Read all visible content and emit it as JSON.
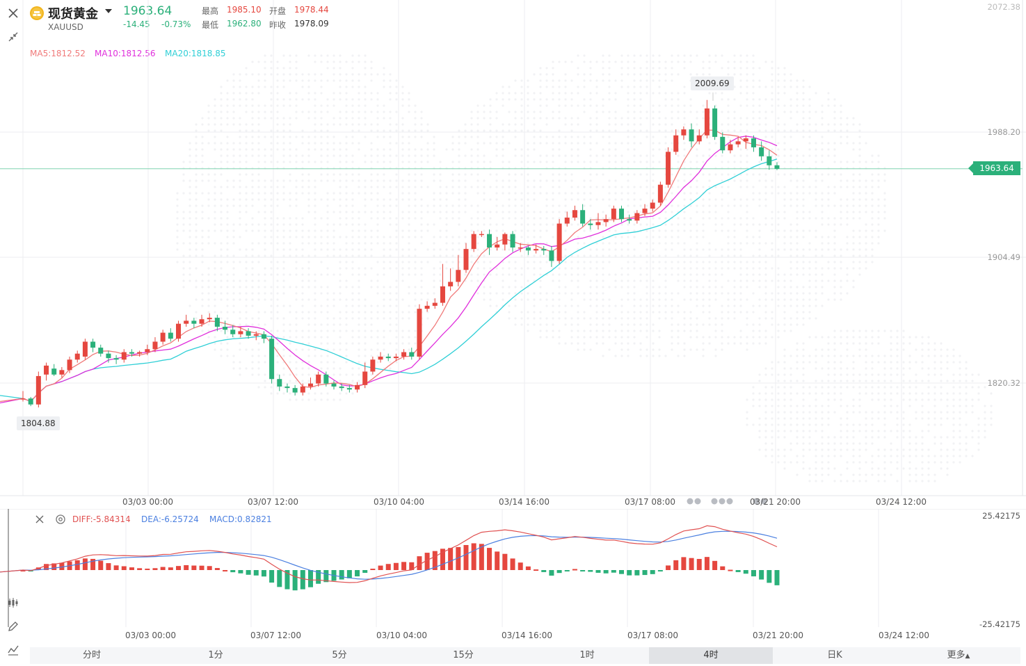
{
  "header": {
    "name": "现货黄金",
    "symbol": "XAUUSD",
    "price": "1963.64",
    "change": "-14.45",
    "change_pct": "-0.73%",
    "high_label": "最高",
    "high_value": "1985.10",
    "open_label": "开盘",
    "open_value": "1978.44",
    "low_label": "最低",
    "low_value": "1962.80",
    "prev_label": "昨收",
    "prev_value": "1978.09"
  },
  "ma_legend": {
    "ma5": "MA5:1812.52",
    "ma10": "MA10:1812.56",
    "ma20": "MA20:1818.85"
  },
  "price_axis": {
    "top": "2072.38",
    "t1": "1988.20",
    "t2": "1904.49",
    "t3": "1820.32"
  },
  "current_price_tag": "1963.64",
  "max_callout": "2009.69",
  "min_callout": "1804.88",
  "dates_main": [
    "03/03 00:00",
    "03/07 12:00",
    "03/10 04:00",
    "03/14 16:00",
    "03/17 08:00",
    "03/21 20:00",
    "03/24 12:00"
  ],
  "dates_macd": [
    "03/03 00:00",
    "03/07 12:00",
    "03/10 04:00",
    "03/14 16:00",
    "03/17 08:00",
    "03/21 20:00",
    "03/24 12:00"
  ],
  "macd_legend": {
    "diff": "DIFF:-5.84314",
    "dea": "DEA:-6.25724",
    "macd": "MACD:0.82821"
  },
  "macd_axis": {
    "top": "25.42175",
    "bottom": "-25.42175"
  },
  "tabs": [
    "分时",
    "1分",
    "5分",
    "15分",
    "1时",
    "4时",
    "日K",
    "更多"
  ],
  "active_tab": "4时",
  "colors": {
    "up": "#e5473f",
    "down": "#2bb07a",
    "ma5": "#f07a7a",
    "ma10": "#e02fdc",
    "ma20": "#2fcfd6",
    "diff": "#e05050",
    "dea": "#4a7fe0"
  },
  "icons": [
    "close-icon",
    "collapse-icon",
    "gold-coin-icon",
    "settings-icon",
    "candlestick-icon",
    "pen-icon",
    "indicator-icon"
  ],
  "chart_data": {
    "type": "candlestick",
    "title": "现货黄金 XAUUSD",
    "interval": "4时",
    "y_range": [
      1780,
      2072.38
    ],
    "candles": [
      [
        1810,
        1810,
        1815,
        1808
      ],
      [
        1810,
        1806,
        1811,
        1804.88
      ],
      [
        1806,
        1825,
        1828,
        1804
      ],
      [
        1826,
        1832,
        1834,
        1822
      ],
      [
        1830,
        1826,
        1833,
        1825
      ],
      [
        1826,
        1829,
        1831,
        1824
      ],
      [
        1829,
        1836,
        1838,
        1827
      ],
      [
        1836,
        1840,
        1842,
        1834
      ],
      [
        1838,
        1848,
        1850,
        1836
      ],
      [
        1848,
        1844,
        1850,
        1841
      ],
      [
        1844,
        1840,
        1846,
        1838
      ],
      [
        1840,
        1837,
        1842,
        1834
      ],
      [
        1837,
        1836,
        1839,
        1833
      ],
      [
        1836,
        1841,
        1843,
        1834
      ],
      [
        1841,
        1840,
        1843,
        1838
      ],
      [
        1840,
        1841,
        1842,
        1838
      ],
      [
        1841,
        1843,
        1846,
        1839
      ],
      [
        1843,
        1848,
        1851,
        1841
      ],
      [
        1848,
        1854,
        1856,
        1846
      ],
      [
        1854,
        1850,
        1857,
        1848
      ],
      [
        1850,
        1860,
        1862,
        1848
      ],
      [
        1860,
        1862,
        1866,
        1858
      ],
      [
        1862,
        1860,
        1864,
        1857
      ],
      [
        1860,
        1863,
        1866,
        1858
      ],
      [
        1863,
        1864,
        1867,
        1861
      ],
      [
        1864,
        1858,
        1866,
        1855
      ],
      [
        1858,
        1856,
        1862,
        1853
      ],
      [
        1856,
        1853,
        1859,
        1851
      ],
      [
        1853,
        1855,
        1858,
        1851
      ],
      [
        1855,
        1852,
        1857,
        1850
      ],
      [
        1852,
        1853,
        1855,
        1849
      ],
      [
        1853,
        1850,
        1855,
        1847
      ],
      [
        1850,
        1823,
        1852,
        1820
      ],
      [
        1823,
        1818,
        1826,
        1815
      ],
      [
        1818,
        1817,
        1820,
        1814
      ],
      [
        1817,
        1814,
        1819,
        1812
      ],
      [
        1814,
        1818,
        1820,
        1812
      ],
      [
        1818,
        1820,
        1824,
        1816
      ],
      [
        1820,
        1826,
        1828,
        1818
      ],
      [
        1826,
        1820,
        1828,
        1818
      ],
      [
        1820,
        1818,
        1822,
        1816
      ],
      [
        1818,
        1817,
        1820,
        1815
      ],
      [
        1817,
        1816,
        1819,
        1814
      ],
      [
        1816,
        1819,
        1821,
        1814
      ],
      [
        1819,
        1828,
        1834,
        1817
      ],
      [
        1828,
        1836,
        1838,
        1826
      ],
      [
        1836,
        1838,
        1841,
        1834
      ],
      [
        1838,
        1837,
        1840,
        1835
      ],
      [
        1837,
        1838,
        1840,
        1835
      ],
      [
        1838,
        1841,
        1843,
        1836
      ],
      [
        1841,
        1838,
        1844,
        1836
      ],
      [
        1838,
        1870,
        1873,
        1836
      ],
      [
        1870,
        1872,
        1875,
        1868
      ],
      [
        1872,
        1874,
        1877,
        1870
      ],
      [
        1874,
        1885,
        1900,
        1872
      ],
      [
        1885,
        1888,
        1897,
        1882
      ],
      [
        1888,
        1896,
        1906,
        1885
      ],
      [
        1896,
        1910,
        1914,
        1894
      ],
      [
        1910,
        1920,
        1922,
        1908
      ],
      [
        1920,
        1920,
        1922,
        1918
      ],
      [
        1920,
        1911,
        1923,
        1906
      ],
      [
        1911,
        1913,
        1918,
        1909
      ],
      [
        1913,
        1920,
        1921,
        1909
      ],
      [
        1920,
        1911,
        1922,
        1908
      ],
      [
        1911,
        1911,
        1914,
        1908
      ],
      [
        1911,
        1909,
        1912,
        1906
      ],
      [
        1909,
        1910,
        1913,
        1907
      ],
      [
        1910,
        1909,
        1912,
        1906
      ],
      [
        1909,
        1902,
        1912,
        1898
      ],
      [
        1902,
        1927,
        1930,
        1900
      ],
      [
        1927,
        1931,
        1935,
        1925
      ],
      [
        1931,
        1936,
        1939,
        1929
      ],
      [
        1936,
        1927,
        1940,
        1925
      ],
      [
        1927,
        1926,
        1930,
        1923
      ],
      [
        1926,
        1928,
        1934,
        1923
      ],
      [
        1928,
        1930,
        1933,
        1925
      ],
      [
        1930,
        1937,
        1939,
        1928
      ],
      [
        1937,
        1930,
        1939,
        1928
      ],
      [
        1930,
        1929,
        1933,
        1927
      ],
      [
        1929,
        1934,
        1936,
        1927
      ],
      [
        1934,
        1937,
        1940,
        1932
      ],
      [
        1937,
        1941,
        1943,
        1935
      ],
      [
        1941,
        1953,
        1955,
        1939
      ],
      [
        1953,
        1975,
        1978,
        1951
      ],
      [
        1975,
        1986,
        1990,
        1973
      ],
      [
        1986,
        1990,
        1992,
        1983
      ],
      [
        1990,
        1982,
        1994,
        1978
      ],
      [
        1982,
        1986,
        1990,
        1980
      ],
      [
        1986,
        2004,
        2009.69,
        1984
      ],
      [
        2004,
        1985,
        2006,
        1983
      ],
      [
        1985,
        1976,
        1988,
        1974
      ],
      [
        1976,
        1980,
        1983,
        1974
      ],
      [
        1980,
        1982,
        1985,
        1978
      ],
      [
        1982,
        1984,
        1986,
        1977
      ],
      [
        1984,
        1978,
        1986,
        1975
      ],
      [
        1978,
        1972,
        1982,
        1969
      ],
      [
        1972,
        1966,
        1976,
        1963
      ],
      [
        1966,
        1963.64,
        1968,
        1962.8
      ]
    ],
    "ma5_last": 1812.52,
    "ma10_last": 1812.56,
    "ma20_last": 1818.85,
    "macd": {
      "range": [
        -25.42175,
        25.42175
      ],
      "diff_last": -5.84314,
      "dea_last": -6.25724,
      "macd_last": 0.82821
    }
  }
}
